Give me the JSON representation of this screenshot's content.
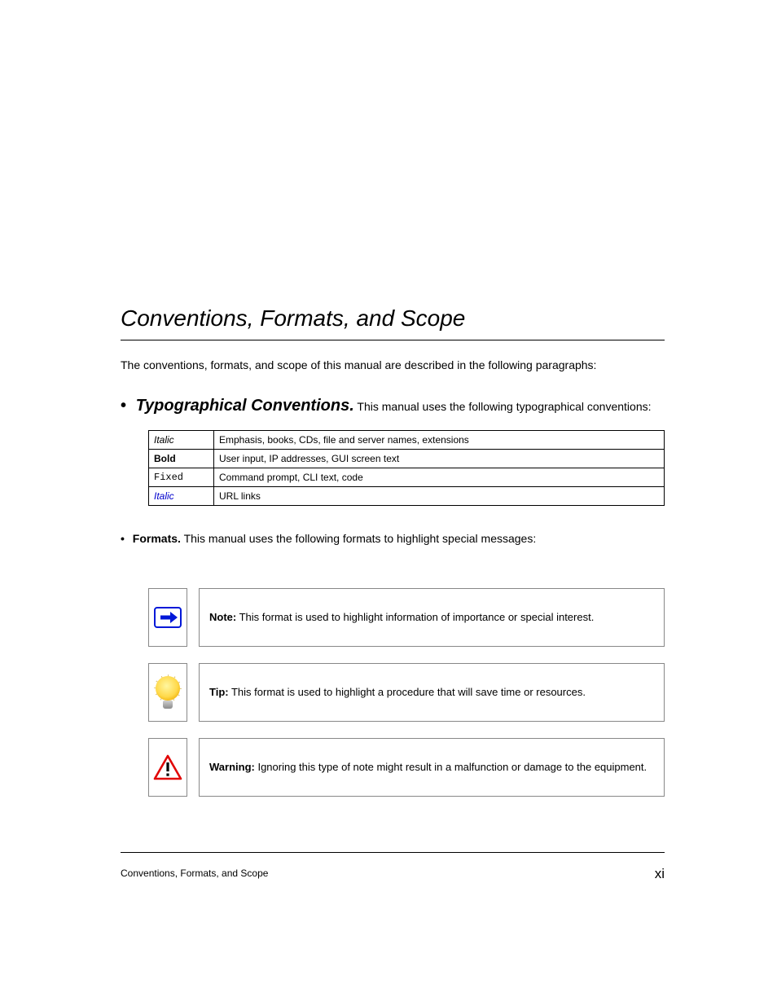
{
  "section": {
    "title": "Conventions, Formats, and Scope",
    "intro_prefix": "The conventions, formats, and scope of this manual are described in the following paragraphs:",
    "typo_title": "Typographical Conventions.",
    "typo_intro": " This manual uses the following typographical conventions:",
    "callouts_intro": "This manual uses the following formats to highlight special messages:"
  },
  "conventions": [
    {
      "style_label": "Italic",
      "style_class": "style-italic",
      "use": "Emphasis, books, CDs, file and server names, extensions"
    },
    {
      "style_label": "Bold",
      "style_class": "style-bold",
      "use": "User input, IP addresses, GUI screen text"
    },
    {
      "style_label": "Fixed",
      "style_class": "style-mono",
      "use": "Command prompt, CLI text, code"
    },
    {
      "style_label": "Italic",
      "style_class": "style-link",
      "use": "URL links"
    }
  ],
  "callouts": {
    "note": "This format is used to highlight information of importance or special interest.",
    "tip": "This format is used to highlight a procedure that will save time or resources.",
    "warning": "Ignoring this type of note might result in a malfunction or damage to the equipment."
  },
  "labels": {
    "note": "Note:",
    "tip": "Tip:",
    "warning": "Warning:"
  },
  "bullet": "•",
  "footer": {
    "left": "Conventions, Formats, and Scope",
    "page": "xi"
  }
}
